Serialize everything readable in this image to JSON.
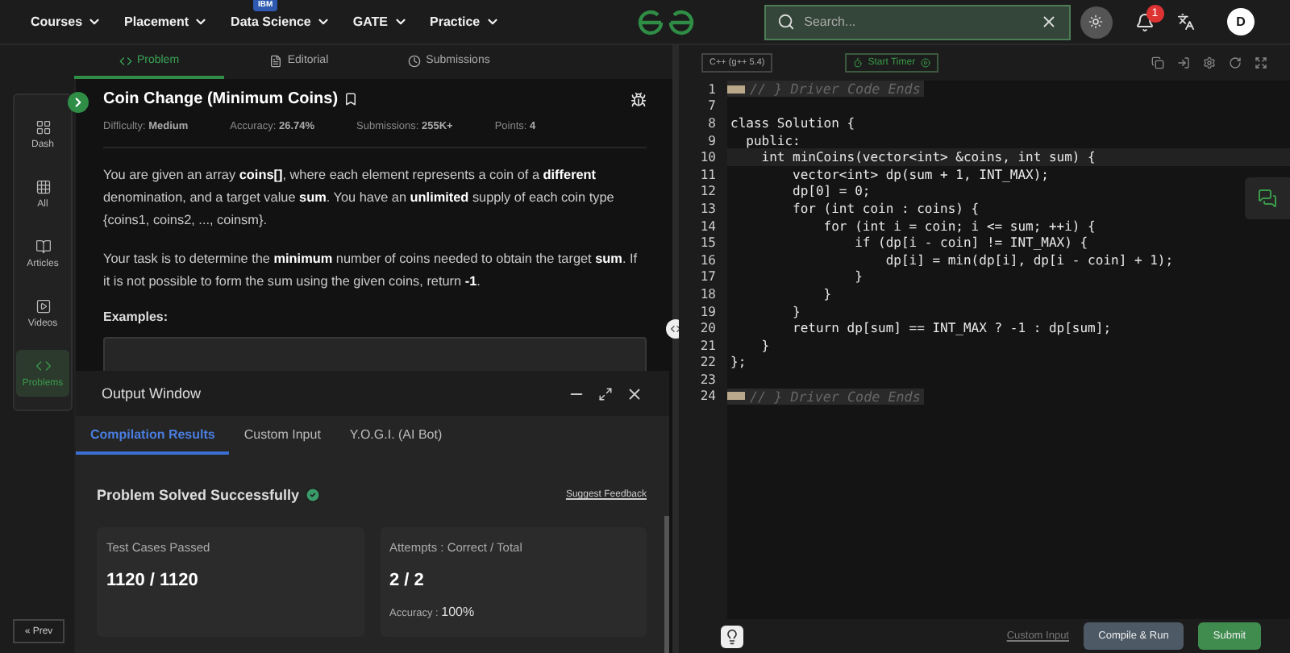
{
  "nav": {
    "items": [
      {
        "label": "Courses"
      },
      {
        "label": "Placement"
      },
      {
        "label": "Data Science",
        "badge": "IBM"
      },
      {
        "label": "GATE"
      },
      {
        "label": "Practice"
      }
    ],
    "search": {
      "placeholder": "Search..."
    },
    "notifications": "1",
    "avatar": "D"
  },
  "sidebar": {
    "items": [
      {
        "label": "Dash",
        "selected": false
      },
      {
        "label": "All",
        "selected": false
      },
      {
        "label": "Articles",
        "selected": false
      },
      {
        "label": "Videos",
        "selected": false
      },
      {
        "label": "Problems",
        "selected": true
      }
    ],
    "prev": "« Prev"
  },
  "tabs": [
    {
      "label": "Problem",
      "selected": true
    },
    {
      "label": "Editorial",
      "selected": false
    },
    {
      "label": "Submissions",
      "selected": false
    }
  ],
  "problem": {
    "title": "Coin Change (Minimum Coins)",
    "meta": [
      {
        "label": "Difficulty:",
        "value": "Medium"
      },
      {
        "label": "Accuracy:",
        "value": "26.74%"
      },
      {
        "label": "Submissions:",
        "value": "255K+"
      },
      {
        "label": "Points:",
        "value": "4"
      }
    ],
    "paragraphs": [
      "You are given an array **coins[]**, where each element represents a coin of a **different** denomination, and a target value **sum**. You have an **unlimited** supply of each coin type {coins1, coins2, ..., coinsm}.",
      "Your task is to determine the **minimum** number of coins needed to obtain the target **sum**. If it is not possible to form the sum using the given coins, return **-1**."
    ],
    "examples_heading": "Examples:"
  },
  "output_window": {
    "title": "Output Window",
    "tabs": [
      {
        "label": "Compilation Results",
        "selected": true
      },
      {
        "label": "Custom Input",
        "selected": false
      },
      {
        "label": "Y.O.G.I. (AI Bot)",
        "selected": false
      }
    ],
    "status": "Problem Solved Successfully",
    "feedback": "Suggest Feedback",
    "cards": [
      {
        "label": "Test Cases Passed",
        "value": "1120 / 1120"
      },
      {
        "label": "Attempts : Correct / Total",
        "value": "2 / 2",
        "extra_label": "Accuracy :",
        "extra_value": "100%"
      }
    ]
  },
  "editor": {
    "language": "C++ (g++ 5.4)",
    "timer": "Start Timer",
    "lines": [
      {
        "number": "1",
        "text": "// } Driver Code Ends",
        "kind": "fold",
        "active": false
      },
      {
        "number": "7",
        "kind": "code",
        "active": false
      },
      {
        "number": "8",
        "text": "class Solution {",
        "kind": "code",
        "active": false
      },
      {
        "number": "9",
        "text": "  public:",
        "kind": "code",
        "active": false
      },
      {
        "number": "10",
        "text": "    int minCoins(vector<int> &coins, int sum) {",
        "kind": "code",
        "active": true
      },
      {
        "number": "11",
        "text": "        vector<int> dp(sum + 1, INT_MAX);",
        "kind": "code",
        "active": false
      },
      {
        "number": "12",
        "text": "        dp[0] = 0;",
        "kind": "code",
        "active": false
      },
      {
        "number": "13",
        "text": "        for (int coin : coins) {",
        "kind": "code",
        "active": false
      },
      {
        "number": "14",
        "text": "            for (int i = coin; i <= sum; ++i) {",
        "kind": "code",
        "active": false
      },
      {
        "number": "15",
        "text": "                if (dp[i - coin] != INT_MAX) {",
        "kind": "code",
        "active": false
      },
      {
        "number": "16",
        "text": "                    dp[i] = min(dp[i], dp[i - coin] + 1);",
        "kind": "code",
        "active": false
      },
      {
        "number": "17",
        "text": "                }",
        "kind": "code",
        "active": false
      },
      {
        "number": "18",
        "text": "            }",
        "kind": "code",
        "active": false
      },
      {
        "number": "19",
        "text": "        }",
        "kind": "code",
        "active": false
      },
      {
        "number": "20",
        "text": "        return dp[sum] == INT_MAX ? -1 : dp[sum];",
        "kind": "code",
        "active": false
      },
      {
        "number": "21",
        "text": "    }",
        "kind": "code",
        "active": false
      },
      {
        "number": "22",
        "text": "};",
        "kind": "code",
        "active": false
      },
      {
        "number": "23",
        "kind": "code",
        "active": false
      },
      {
        "number": "24",
        "text": "// } Driver Code Ends",
        "kind": "fold",
        "active": false
      }
    ],
    "custom_input": "Custom Input",
    "compile": "Compile & Run",
    "submit": "Submit"
  }
}
